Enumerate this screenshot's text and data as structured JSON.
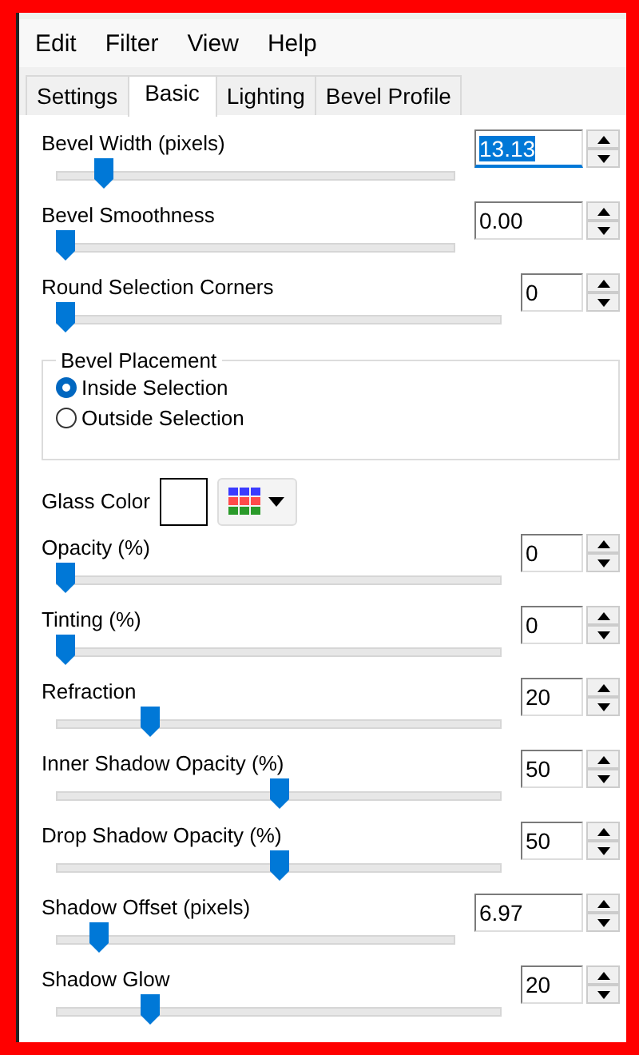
{
  "menu": [
    "Edit",
    "Filter",
    "View",
    "Help"
  ],
  "tabs": [
    {
      "label": "Settings",
      "selected": false
    },
    {
      "label": "Basic",
      "selected": true
    },
    {
      "label": "Lighting",
      "selected": false
    },
    {
      "label": "Bevel Profile",
      "selected": false
    }
  ],
  "sliders_top": [
    {
      "label": "Bevel Width (pixels)",
      "value": "13.13",
      "level": 0.1,
      "wide": true,
      "focused": true
    },
    {
      "label": "Bevel Smoothness",
      "value": "0.00",
      "level": 0,
      "wide": true,
      "focused": false
    },
    {
      "label": "Round Selection Corners",
      "value": "0",
      "level": 0,
      "wide": false,
      "focused": false
    }
  ],
  "bevel_placement": {
    "title": "Bevel Placement",
    "options": [
      {
        "label": "Inside Selection",
        "selected": true
      },
      {
        "label": "Outside Selection",
        "selected": false
      }
    ]
  },
  "glass_color": {
    "label": "Glass Color",
    "color": "#ffffff"
  },
  "sliders_bottom": [
    {
      "label": "Opacity (%)",
      "value": "0",
      "level": 0,
      "wide": false,
      "focused": false
    },
    {
      "label": "Tinting (%)",
      "value": "0",
      "level": 0,
      "wide": false,
      "focused": false
    },
    {
      "label": "Refraction",
      "value": "20",
      "level": 0.2,
      "wide": false,
      "focused": false
    },
    {
      "label": "Inner Shadow Opacity (%)",
      "value": "50",
      "level": 0.5,
      "wide": false,
      "focused": false
    },
    {
      "label": "Drop Shadow Opacity (%)",
      "value": "50",
      "level": 0.5,
      "wide": false,
      "focused": false
    },
    {
      "label": "Shadow Offset (pixels)",
      "value": "6.97",
      "level": 0.09,
      "wide": true,
      "focused": false
    },
    {
      "label": "Shadow Glow",
      "value": "20",
      "level": 0.2,
      "wide": false,
      "focused": false
    }
  ]
}
